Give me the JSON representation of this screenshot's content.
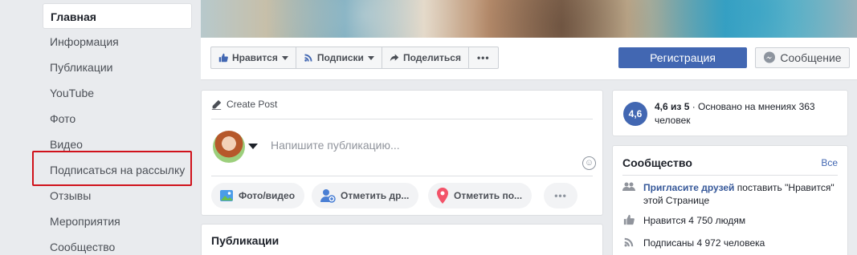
{
  "nav": {
    "items": [
      {
        "label": "Главная",
        "active": true
      },
      {
        "label": "Информация"
      },
      {
        "label": "Публикации"
      },
      {
        "label": "YouTube"
      },
      {
        "label": "Фото"
      },
      {
        "label": "Видео"
      },
      {
        "label": "Подписаться на рассылку",
        "highlighted": true
      },
      {
        "label": "Отзывы"
      },
      {
        "label": "Мероприятия"
      },
      {
        "label": "Сообщество"
      }
    ]
  },
  "actions": {
    "like": "Нравится",
    "follow": "Подписки",
    "share": "Поделиться",
    "register": "Регистрация",
    "message": "Сообщение"
  },
  "create_post": {
    "header": "Create Post",
    "placeholder": "Напишите публикацию...",
    "buttons": {
      "photo": "Фото/видео",
      "tag": "Отметить др...",
      "checkin": "Отметить по..."
    }
  },
  "posts": {
    "title": "Публикации"
  },
  "rating": {
    "badge": "4,6",
    "score": "4,6 из 5",
    "text": " · Основано на мнениях 363 человек"
  },
  "community": {
    "title": "Сообщество",
    "see_all": "Все",
    "invite_link": "Пригласите друзей",
    "invite_text": " поставить \"Нравится\" этой Странице",
    "likes": "Нравится 4 750 людям",
    "followers": "Подписаны 4 972 человека"
  },
  "colors": {
    "accent": "#4267b2",
    "highlight": "#d0121b"
  }
}
